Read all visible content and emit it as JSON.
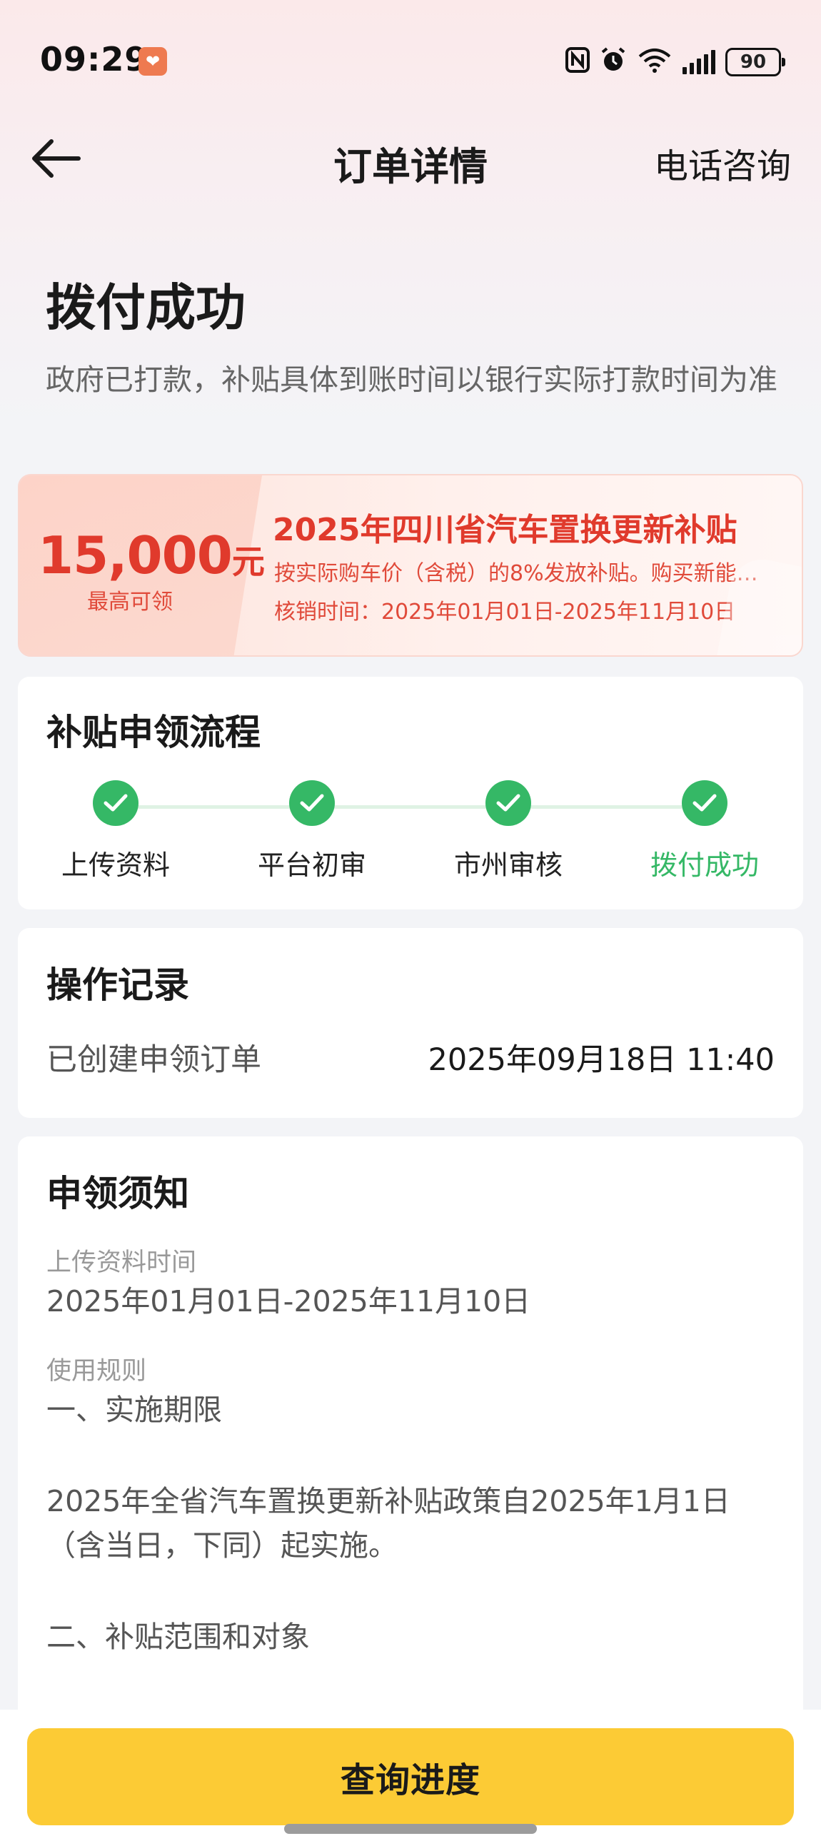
{
  "status_bar": {
    "time": "09:29",
    "battery": "90",
    "icons": [
      "app-notification-icon",
      "nfc-icon",
      "alarm-icon",
      "wifi-icon",
      "signal-icon",
      "battery-icon"
    ]
  },
  "nav": {
    "title": "订单详情",
    "phone_label": "电话咨询"
  },
  "header": {
    "status": "拨付成功",
    "description": "政府已打款，补贴具体到账时间以银行实际打款时间为准"
  },
  "subsidy": {
    "amount": "15,000",
    "unit": "元",
    "amount_caption": "最高可领",
    "title": "2025年四川省汽车置换更新补贴",
    "rule": "按实际购车价（含税）的8%发放补贴。购买新能…",
    "period": "核销时间：2025年01月01日-2025年11月10日"
  },
  "process": {
    "title": "补贴申领流程",
    "steps": [
      {
        "label": "上传资料"
      },
      {
        "label": "平台初审"
      },
      {
        "label": "市州审核"
      },
      {
        "label": "拨付成功"
      }
    ],
    "accent": "#35b866"
  },
  "records": {
    "title": "操作记录",
    "items": [
      {
        "label": "已创建申领订单",
        "time": "2025年09月18日 11:40"
      }
    ]
  },
  "notice": {
    "title": "申领须知",
    "upload_time_label": "上传资料时间",
    "upload_time_value": "2025年01月01日-2025年11月10日",
    "rules_label": "使用规则",
    "rule_1_heading": "一、实施期限",
    "rule_1_text": "2025年全省汽车置换更新补贴政策自2025年1月1日（含当日，下同）起实施。",
    "rule_2_heading": "二、补贴范围和对象"
  },
  "footer": {
    "button_label": "查询进度",
    "button_color": "#fccb35"
  }
}
